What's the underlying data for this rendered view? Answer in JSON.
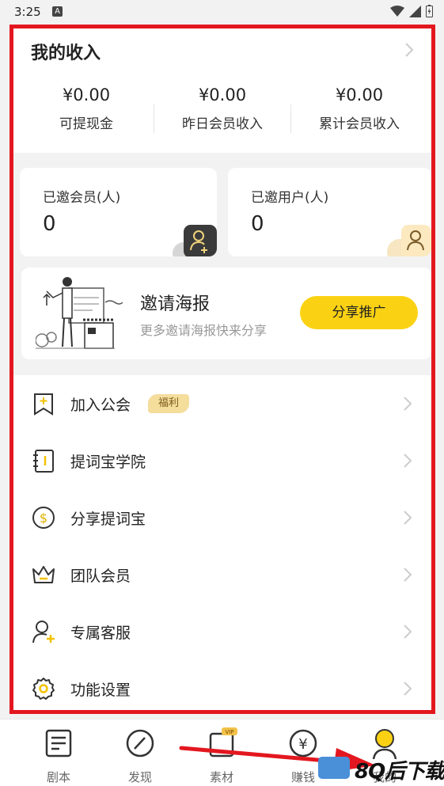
{
  "status_bar": {
    "time": "3:25",
    "badge": "A"
  },
  "income": {
    "title": "我的收入",
    "items": [
      {
        "amount": "¥0.00",
        "label": "可提现金"
      },
      {
        "amount": "¥0.00",
        "label": "昨日会员收入"
      },
      {
        "amount": "¥0.00",
        "label": "累计会员收入"
      }
    ]
  },
  "invited_members": {
    "label": "已邀会员(人)",
    "count": "0"
  },
  "invited_users": {
    "label": "已邀用户(人)",
    "count": "0"
  },
  "poster": {
    "title": "邀请海报",
    "subtitle": "更多邀请海报快来分享",
    "button": "分享推广"
  },
  "menu": [
    {
      "label": "加入公会",
      "tag": "福利",
      "icon": "bookmark-icon"
    },
    {
      "label": "提词宝学院",
      "icon": "notebook-icon"
    },
    {
      "label": "分享提词宝",
      "icon": "coin-icon"
    },
    {
      "label": "团队会员",
      "icon": "crown-icon"
    },
    {
      "label": "专属客服",
      "icon": "user-plus-icon"
    },
    {
      "label": "功能设置",
      "icon": "gear-icon"
    }
  ],
  "bottom_nav": [
    {
      "label": "剧本",
      "icon": "script-icon"
    },
    {
      "label": "发现",
      "icon": "compass-icon"
    },
    {
      "label": "素材",
      "icon": "material-icon",
      "badge": "VIP"
    },
    {
      "label": "赚钱",
      "icon": "yen-icon"
    },
    {
      "label": "我的",
      "icon": "profile-icon"
    }
  ],
  "watermark": "8Q后下载",
  "colors": {
    "accent": "#fbd213",
    "frame": "#e3171f",
    "tag_bg": "#f5dd9c"
  }
}
